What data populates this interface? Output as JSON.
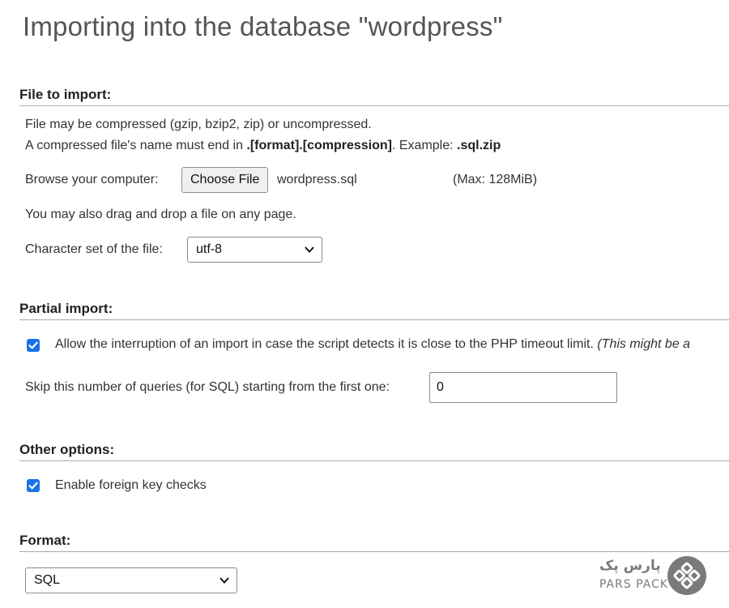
{
  "page": {
    "title": "Importing into the database \"wordpress\""
  },
  "file_to_import": {
    "header": "File to import:",
    "line1": "File may be compressed (gzip, bzip2, zip) or uncompressed.",
    "line2_prefix": "A compressed file's name must end in ",
    "line2_bold": ".[format].[compression]",
    "line2_mid": ". Example: ",
    "line2_example": ".sql.zip",
    "browse_label": "Browse your computer:",
    "choose_button": "Choose File",
    "file_name": "wordpress.sql",
    "max_size": "(Max: 128MiB)",
    "drag_hint": "You may also drag and drop a file on any page.",
    "charset_label": "Character set of the file:",
    "charset_value": "utf-8"
  },
  "partial_import": {
    "header": "Partial import:",
    "allow_interrupt_label": "Allow the interruption of an import in case the script detects it is close to the PHP timeout limit.",
    "allow_interrupt_note": "(This might be a",
    "allow_interrupt_checked": true,
    "skip_label": "Skip this number of queries (for SQL) starting from the first one:",
    "skip_value": "0"
  },
  "other_options": {
    "header": "Other options:",
    "foreign_key_label": "Enable foreign key checks",
    "foreign_key_checked": true
  },
  "format": {
    "header": "Format:",
    "value": "SQL"
  },
  "branding": {
    "logo_text": "PARS PACK",
    "logo_text_fa": "پارس پک",
    "logo_color": "#7a7a7a"
  },
  "colors": {
    "checkbox": "#1a73e8",
    "title": "#555555"
  }
}
